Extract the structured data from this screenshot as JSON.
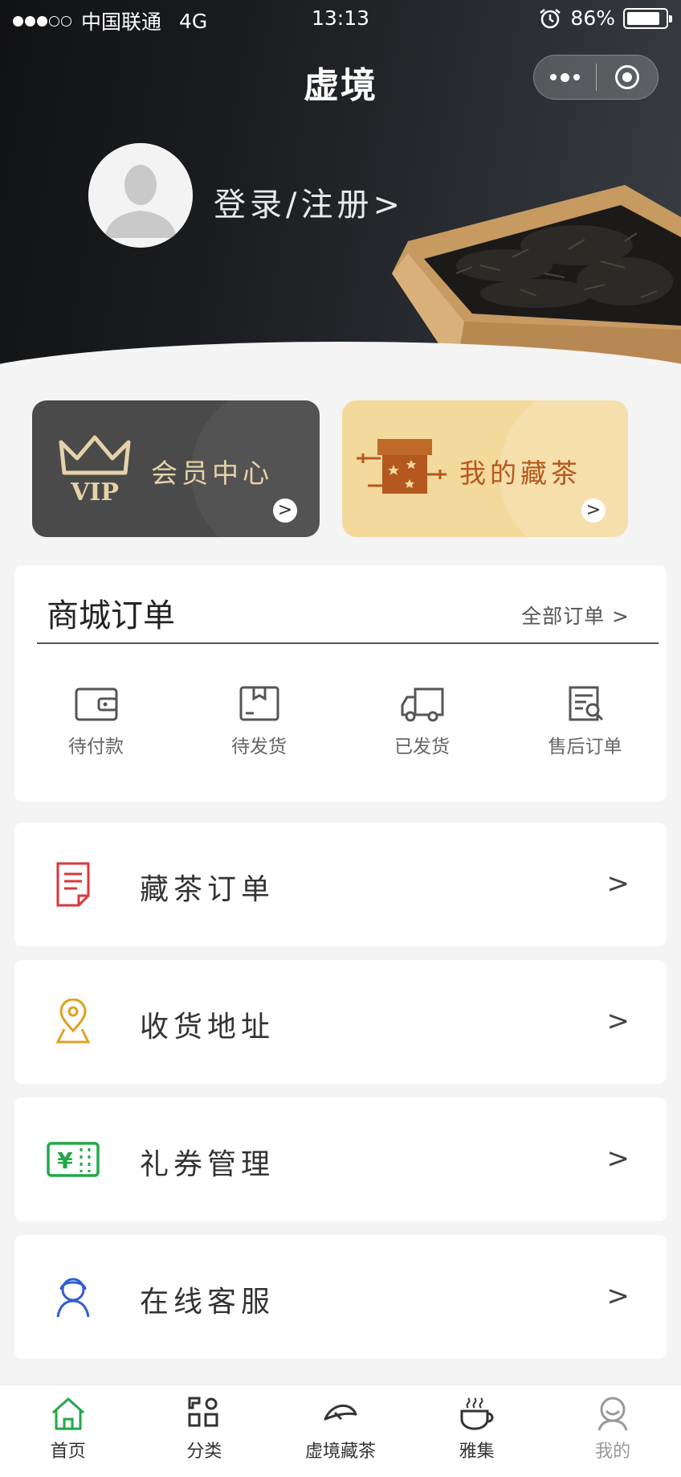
{
  "status_bar": {
    "carrier": "中国联通",
    "network": "4G",
    "time": "13:13",
    "battery": "86%",
    "battery_level": 0.86
  },
  "header": {
    "brand": "虚境",
    "login_text": "登录/注册>"
  },
  "cards": {
    "vip": {
      "label": "会员中心",
      "badge": "VIP",
      "arrow": ">"
    },
    "tea": {
      "label": "我的藏茶",
      "arrow": ">"
    }
  },
  "orders": {
    "title": "商城订单",
    "all_link": "全部订单 >",
    "items": [
      {
        "label": "待付款",
        "icon": "wallet-icon"
      },
      {
        "label": "待发货",
        "icon": "box-icon"
      },
      {
        "label": "已发货",
        "icon": "truck-icon"
      },
      {
        "label": "售后订单",
        "icon": "search-document-icon"
      }
    ]
  },
  "menu": [
    {
      "label": "藏茶订单",
      "icon": "document-icon",
      "color": "#d9373e",
      "chevron": ">"
    },
    {
      "label": "收货地址",
      "icon": "location-pin-icon",
      "color": "#e0a020",
      "chevron": ">"
    },
    {
      "label": "礼券管理",
      "icon": "coupon-icon",
      "color": "#22a848",
      "chevron": ">"
    },
    {
      "label": "在线客服",
      "icon": "customer-service-icon",
      "color": "#2f5fd0",
      "chevron": ">"
    }
  ],
  "tabbar": [
    {
      "label": "首页",
      "icon": "home-icon",
      "active": true
    },
    {
      "label": "分类",
      "icon": "category-icon"
    },
    {
      "label": "虚境藏茶",
      "icon": "tea-leaf-icon"
    },
    {
      "label": "雅集",
      "icon": "tea-cup-icon"
    },
    {
      "label": "我的",
      "icon": "user-icon"
    }
  ],
  "colors": {
    "accent_green": "#22a848",
    "vip_card": "#4a4a4a",
    "tea_card": "#f3d99c",
    "tea_card_text": "#b5581f"
  }
}
